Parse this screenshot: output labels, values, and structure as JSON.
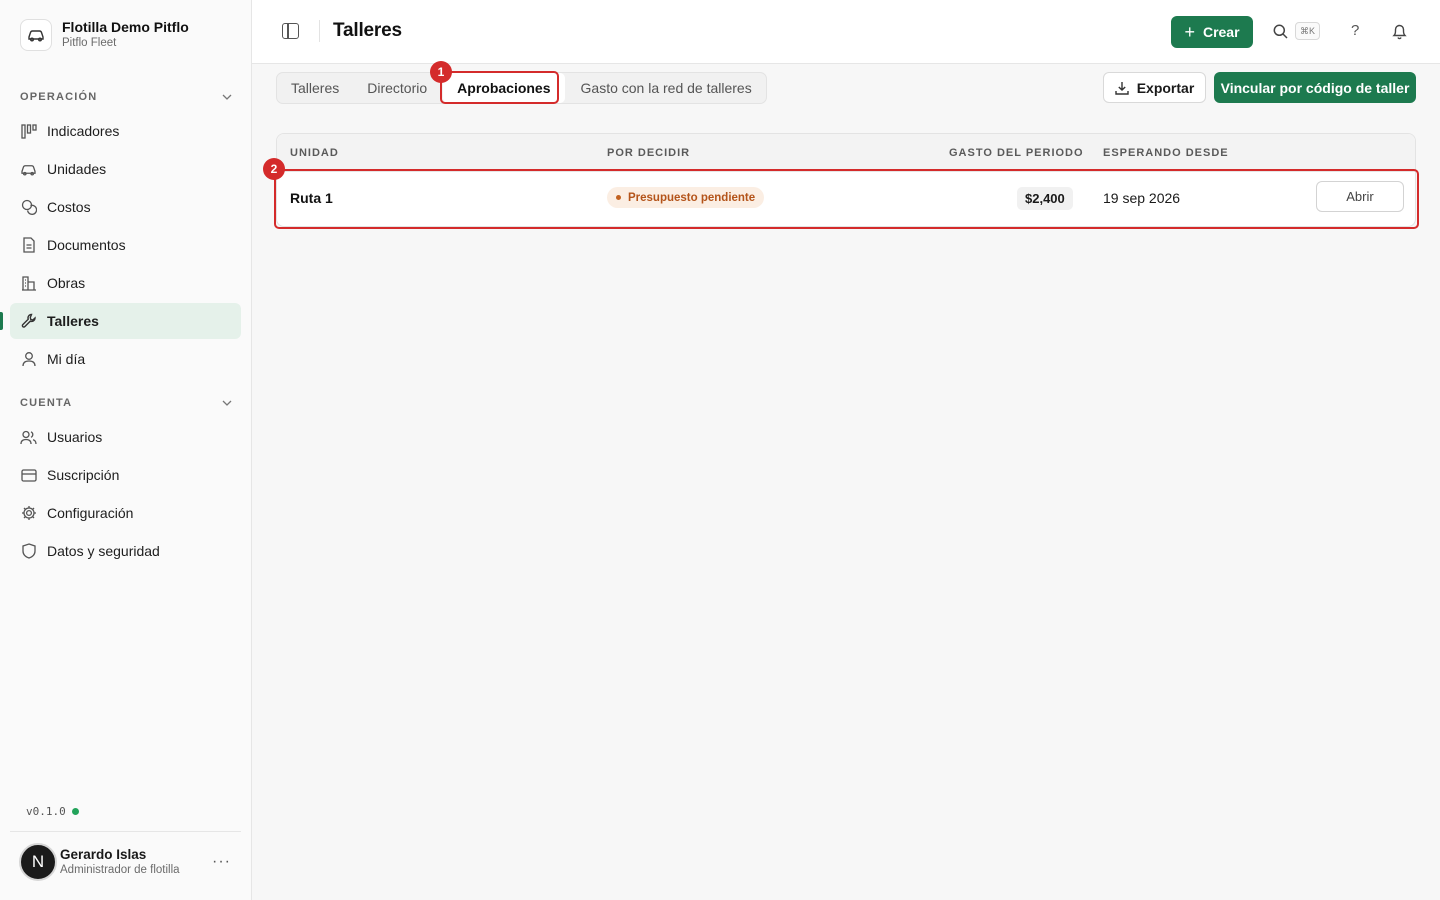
{
  "brand": {
    "name": "Flotilla Demo Pitflo",
    "subtitle": "Pitflo Fleet",
    "icon": "car-icon"
  },
  "sidebar": {
    "sections": [
      {
        "title": "OPERACIÓN",
        "items": [
          {
            "label": "Indicadores",
            "icon": "kanban-icon"
          },
          {
            "label": "Unidades",
            "icon": "car-icon"
          },
          {
            "label": "Costos",
            "icon": "coins-icon"
          },
          {
            "label": "Documentos",
            "icon": "document-icon"
          },
          {
            "label": "Obras",
            "icon": "building-icon"
          },
          {
            "label": "Talleres",
            "icon": "wrench-icon",
            "active": true
          },
          {
            "label": "Mi día",
            "icon": "user-icon"
          }
        ]
      },
      {
        "title": "CUENTA",
        "items": [
          {
            "label": "Usuarios",
            "icon": "users-icon"
          },
          {
            "label": "Suscripción",
            "icon": "credit-card-icon"
          },
          {
            "label": "Configuración",
            "icon": "gear-icon"
          },
          {
            "label": "Datos y seguridad",
            "icon": "shield-icon"
          }
        ]
      }
    ],
    "version": "v0.1.0",
    "user": {
      "initial": "N",
      "name": "Gerardo Islas",
      "role": "Administrador de flotilla",
      "more": "···"
    }
  },
  "header": {
    "title": "Talleres",
    "create_label": "Crear",
    "shortcut": "⌘K",
    "help": "?"
  },
  "tabs": [
    {
      "label": "Talleres"
    },
    {
      "label": "Directorio"
    },
    {
      "label": "Aprobaciones",
      "active": true
    },
    {
      "label": "Gasto con la red de talleres"
    }
  ],
  "actions": {
    "export_label": "Exportar",
    "link_label": "Vincular por código de taller"
  },
  "table": {
    "columns": [
      "UNIDAD",
      "POR DECIDIR",
      "GASTO DEL PERIODO",
      "ESPERANDO DESDE"
    ],
    "rows": [
      {
        "unit": "Ruta 1",
        "status": "Presupuesto pendiente",
        "amount": "$2,400",
        "since": "19 sep 2026",
        "action": "Abrir"
      }
    ]
  },
  "annotations": [
    "1",
    "2"
  ],
  "colors": {
    "accent": "#1d7a4f",
    "highlight": "#d42b2b",
    "badge_text": "#b4541a",
    "badge_bg": "#fbeee3"
  }
}
